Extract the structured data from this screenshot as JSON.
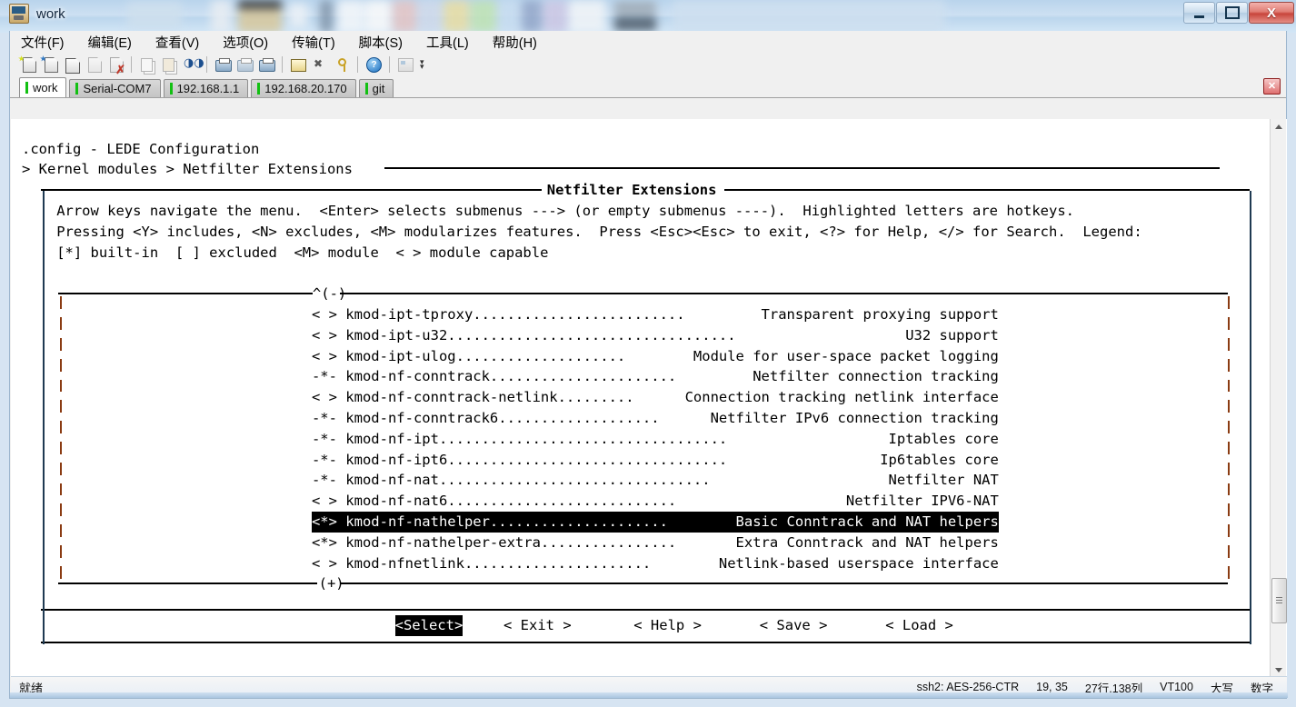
{
  "window": {
    "title": "work",
    "icon": "terminal-app-icon",
    "buttons": {
      "minimize": "–",
      "maximize": "□",
      "close": "X"
    }
  },
  "menubar": [
    {
      "name": "file",
      "label": "文件(F)"
    },
    {
      "name": "edit",
      "label": "编辑(E)"
    },
    {
      "name": "view",
      "label": "查看(V)"
    },
    {
      "name": "options",
      "label": "选项(O)"
    },
    {
      "name": "transfer",
      "label": "传输(T)"
    },
    {
      "name": "script",
      "label": "脚本(S)"
    },
    {
      "name": "tools",
      "label": "工具(L)"
    },
    {
      "name": "help",
      "label": "帮助(H)"
    }
  ],
  "toolbar": {
    "icons": [
      "new-session-icon",
      "clone-session-icon",
      "new-tab-icon",
      "reconnect-icon",
      "disconnect-icon",
      "copy-icon",
      "paste-icon",
      "find-icon",
      "log-session-icon",
      "print-screen-icon",
      "print-icon",
      "session-options-icon",
      "global-options-icon",
      "key-icon",
      "help-icon",
      "arrange-windows-icon"
    ],
    "overflow": "toolbar-overflow-chevron"
  },
  "tabs": [
    {
      "label": "work",
      "active": true
    },
    {
      "label": "Serial-COM7",
      "active": false
    },
    {
      "label": "192.168.1.1",
      "active": false
    },
    {
      "label": "192.168.20.170",
      "active": false
    },
    {
      "label": "git",
      "active": false
    }
  ],
  "tab_close_label": "✕",
  "terminal": {
    "header_line1": ".config - LEDE Configuration",
    "header_line2": "> Kernel modules > Netfilter Extensions",
    "dialog_title": "Netfilter Extensions",
    "help_lines": [
      "Arrow keys navigate the menu.  <Enter> selects submenus ---> (or empty submenus ----).  Highlighted letters are hotkeys.",
      "Pressing <Y> includes, <N> excludes, <M> modularizes features.  Press <Esc><Esc> to exit, <?> for Help, </> for Search.  Legend:",
      "[*] built-in  [ ] excluded  <M> module  < > module capable"
    ],
    "scroll_up_marker": "^(-)",
    "scroll_down_marker": "(+)",
    "menu_items": [
      {
        "state": "< >",
        "name": "kmod-ipt-tproxy",
        "dots": ".........................",
        "desc": "Transparent proxying support",
        "selected": false
      },
      {
        "state": "< >",
        "name": "kmod-ipt-u32",
        "dots": "..................................",
        "desc": "U32 support",
        "selected": false
      },
      {
        "state": "< >",
        "name": "kmod-ipt-ulog",
        "dots": "....................",
        "desc": "Module for user-space packet logging",
        "selected": false
      },
      {
        "state": "-*-",
        "name": "kmod-nf-conntrack",
        "dots": "......................",
        "desc": "Netfilter connection tracking",
        "selected": false
      },
      {
        "state": "< >",
        "name": "kmod-nf-conntrack-netlink",
        "dots": ".........",
        "desc": "Connection tracking netlink interface",
        "selected": false
      },
      {
        "state": "-*-",
        "name": "kmod-nf-conntrack6",
        "dots": "...................",
        "desc": "Netfilter IPv6 connection tracking",
        "selected": false
      },
      {
        "state": "-*-",
        "name": "kmod-nf-ipt",
        "dots": "..................................",
        "desc": "Iptables core",
        "selected": false
      },
      {
        "state": "-*-",
        "name": "kmod-nf-ipt6",
        "dots": ".................................",
        "desc": "Ip6tables core",
        "selected": false
      },
      {
        "state": "-*-",
        "name": "kmod-nf-nat",
        "dots": "................................",
        "desc": "Netfilter NAT",
        "selected": false
      },
      {
        "state": "< >",
        "name": "kmod-nf-nat6",
        "dots": "...........................",
        "desc": "Netfilter IPV6-NAT",
        "selected": false
      },
      {
        "state": "<*>",
        "name": "kmod-nf-nathelper",
        "dots": ".....................",
        "desc": "Basic Conntrack and NAT helpers",
        "selected": true
      },
      {
        "state": "<*>",
        "name": "kmod-nf-nathelper-extra",
        "dots": "................",
        "desc": "Extra Conntrack and NAT helpers",
        "selected": false
      },
      {
        "state": "< >",
        "name": "kmod-nfnetlink",
        "dots": "......................",
        "desc": "Netlink-based userspace interface",
        "selected": false
      }
    ],
    "buttons": [
      {
        "name": "select",
        "label": "<Select>",
        "selected": true
      },
      {
        "name": "exit",
        "label": "< Exit >",
        "selected": false
      },
      {
        "name": "help",
        "label": "< Help >",
        "selected": false
      },
      {
        "name": "save",
        "label": "< Save >",
        "selected": false
      },
      {
        "name": "load",
        "label": "< Load >",
        "selected": false
      }
    ]
  },
  "statusbar": {
    "left": "就绪",
    "cells": [
      "ssh2: AES-256-CTR",
      "19, 35",
      "27行,138列",
      "VT100",
      "大写",
      "数字"
    ]
  },
  "colors": {
    "terminal_bg": "#ffffff",
    "terminal_fg": "#000000",
    "highlight_bg": "#000000",
    "highlight_fg": "#ffffff",
    "tab_indicator": "#12c012",
    "close_button": "#c8453c"
  }
}
